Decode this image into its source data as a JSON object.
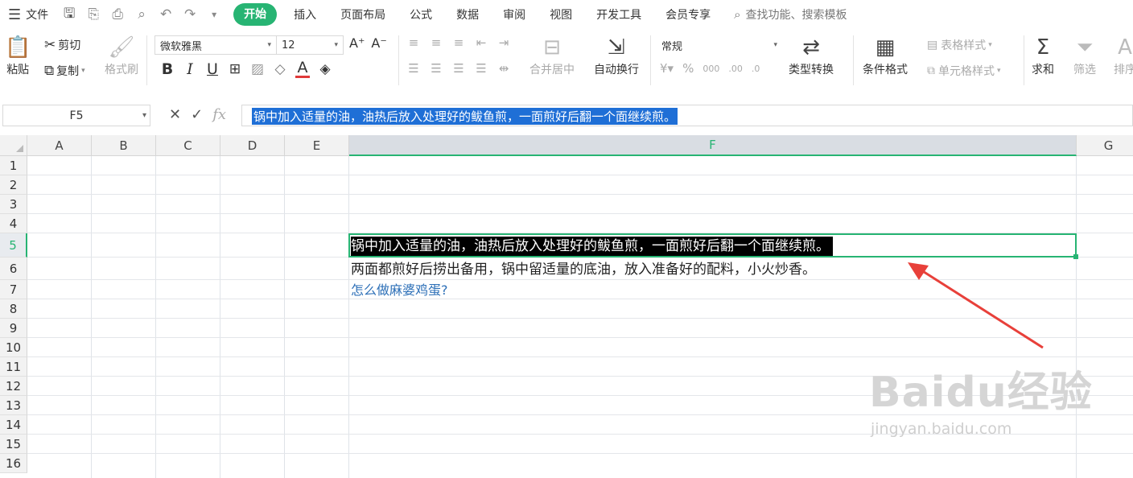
{
  "menubar": {
    "file": "文件",
    "tabs": [
      "开始",
      "插入",
      "页面布局",
      "公式",
      "数据",
      "审阅",
      "视图",
      "开发工具",
      "会员专享"
    ],
    "search": "查找功能、搜索模板"
  },
  "ribbon": {
    "paste": "粘贴",
    "cut": "剪切",
    "copy": "复制",
    "format_painter": "格式刷",
    "font_name": "微软雅黑",
    "font_size": "12",
    "merge_center": "合并居中",
    "wrap_text": "自动换行",
    "number_format": "常规",
    "type_convert": "类型转换",
    "conditional_format": "条件格式",
    "table_style": "表格样式",
    "cell_style": "单元格样式",
    "sum": "求和",
    "filter": "筛选",
    "sort": "排序"
  },
  "formula_bar": {
    "name_box": "F5",
    "content": "锅中加入适量的油，油热后放入处理好的鲅鱼煎，一面煎好后翻一个面继续煎。"
  },
  "columns": [
    "A",
    "B",
    "C",
    "D",
    "E",
    "F",
    "G"
  ],
  "rows": [
    "1",
    "2",
    "3",
    "4",
    "5",
    "6",
    "7",
    "8",
    "9",
    "10",
    "11",
    "12",
    "13",
    "14",
    "15",
    "16"
  ],
  "cells": {
    "F5": "锅中加入适量的油，油热后放入处理好的鲅鱼煎，一面煎好后翻一个面继续煎。",
    "F6": "两面都煎好后捞出备用，锅中留适量的底油，放入准备好的配料，小火炒香。",
    "F7": "怎么做麻婆鸡蛋?"
  },
  "watermark": {
    "logo": "Baidu经验",
    "url": "jingyan.baidu.com"
  },
  "colors": {
    "accent": "#27b473",
    "selection_bg": "#1f6fd6",
    "arrow": "#e8403a",
    "link": "#2c6fb7"
  }
}
